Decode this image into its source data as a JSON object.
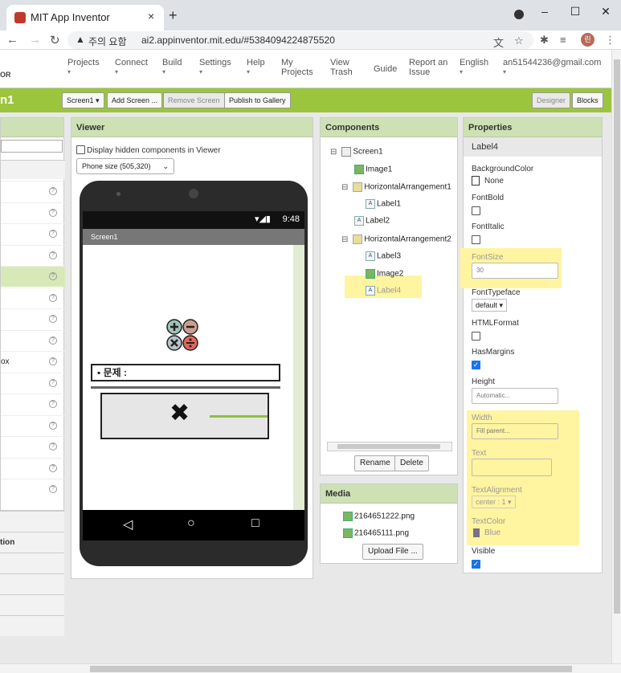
{
  "browser": {
    "tab_title": "MIT App Inventor",
    "tab_close": "×",
    "new_tab": "+",
    "win_min": "–",
    "win_max": "☐",
    "win_close": "✕",
    "warning_icon": "▲",
    "warning_text": "주의 요함",
    "url": "ai2.appinventor.mit.edu/#5384094224875520",
    "avatar_letter": "린"
  },
  "menu": {
    "logo": "OR",
    "items": [
      {
        "label": "Projects",
        "sub": "▾"
      },
      {
        "label": "Connect",
        "sub": "▾"
      },
      {
        "label": "Build",
        "sub": "▾"
      },
      {
        "label": "Settings",
        "sub": "▾"
      },
      {
        "label": "Help",
        "sub": "▾"
      },
      {
        "label": "My Projects",
        "sub": ""
      },
      {
        "label": "View Trash",
        "sub": ""
      },
      {
        "label": "Guide",
        "sub": ""
      },
      {
        "label": "Report an Issue",
        "sub": ""
      },
      {
        "label": "English",
        "sub": "▾"
      },
      {
        "label": "an51544236@gmail.com",
        "sub": "▾"
      }
    ]
  },
  "toolbar": {
    "screen_name": "n1",
    "screen_select": "Screen1 ▾",
    "add_screen": "Add Screen ...",
    "remove_screen": "Remove Screen",
    "publish": "Publish to Gallery",
    "designer": "Designer",
    "blocks": "Blocks"
  },
  "palette": {
    "partial_items": [
      "",
      "",
      "",
      "",
      "",
      "",
      "",
      "",
      "ox",
      "",
      "",
      "",
      "",
      "",
      ""
    ],
    "sections_below": [
      "",
      "tion",
      "",
      "",
      "",
      ""
    ]
  },
  "viewer": {
    "header": "Viewer",
    "hidden_checkbox": "Display hidden components in Viewer",
    "phone_size": "Phone size (505,320)",
    "status_time": "9:48",
    "status_icons": "▾◢▮",
    "screen_title": "Screen1",
    "question_label": "▪ 문제 :",
    "big_x": "✖",
    "nav_back": "◁",
    "nav_home": "○",
    "nav_recent": "□"
  },
  "components": {
    "header": "Components",
    "tree": [
      {
        "toggle": "⊟",
        "icon": "scr",
        "label": "Screen1",
        "level": 0
      },
      {
        "toggle": "",
        "icon": "img",
        "label": "Image1",
        "level": 1
      },
      {
        "toggle": "⊟",
        "icon": "har",
        "label": "HorizontalArrangement1",
        "level": 1
      },
      {
        "toggle": "",
        "icon": "lbl",
        "label": "Label1",
        "level": 2
      },
      {
        "toggle": "",
        "icon": "lbl",
        "label": "Label2",
        "level": 1
      },
      {
        "toggle": "⊟",
        "icon": "har",
        "label": "HorizontalArrangement2",
        "level": 1
      },
      {
        "toggle": "",
        "icon": "lbl",
        "label": "Label3",
        "level": 2
      },
      {
        "toggle": "",
        "icon": "img",
        "label": "Image2",
        "level": 2
      },
      {
        "toggle": "",
        "icon": "lbl",
        "label": "Label4",
        "level": 2
      }
    ],
    "rename": "Rename",
    "delete": "Delete"
  },
  "media": {
    "header": "Media",
    "files": [
      "2164651222.png",
      "216465111.png"
    ],
    "upload": "Upload File ..."
  },
  "properties": {
    "header": "Properties",
    "selected": "Label4",
    "bgcolor_label": "BackgroundColor",
    "bgcolor_value": "None",
    "fontbold_label": "FontBold",
    "fontitalic_label": "FontItalic",
    "fontsize_label": "FontSize",
    "fontsize_value": "30",
    "typeface_label": "FontTypeface",
    "typeface_value": "default ▾",
    "htmlformat_label": "HTMLFormat",
    "hasmargins_label": "HasMargins",
    "height_label": "Height",
    "height_value": "Automatic...",
    "width_label": "Width",
    "width_value": "Fill parent...",
    "text_label": "Text",
    "text_value": "",
    "textalign_label": "TextAlignment",
    "textalign_value": "center : 1 ▾",
    "textcolor_label": "TextColor",
    "textcolor_value": "Blue",
    "visible_label": "Visible",
    "check_mark": "✓"
  },
  "colors": {
    "green_bar": "#9bc53d",
    "panel_header": "#cde1b4",
    "highlight": "#fff4a0",
    "text_color_swatch": "#7b6f8a"
  }
}
